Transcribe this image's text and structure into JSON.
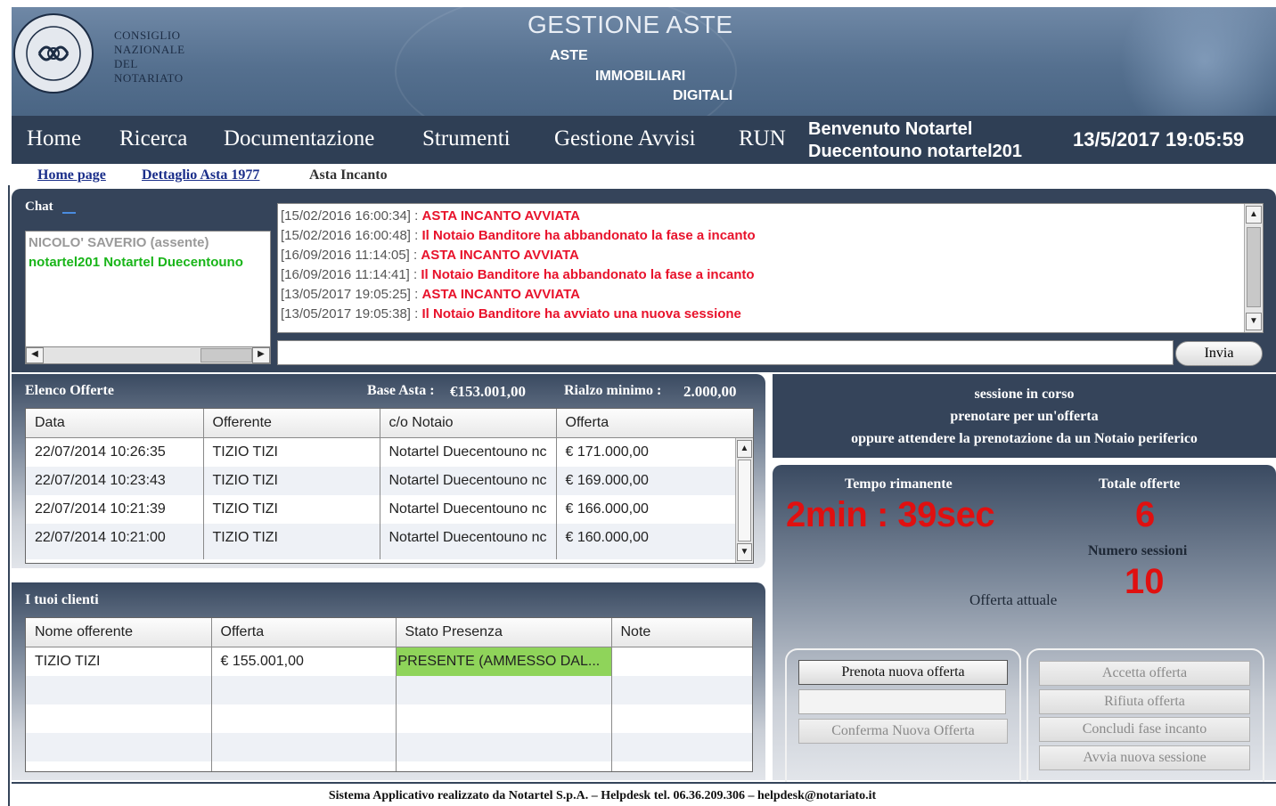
{
  "header": {
    "org_lines": [
      "CONSIGLIO",
      "NAZIONALE",
      "DEL",
      "NOTARIATO"
    ],
    "seal_text": "FIDELI VERITATIS ANCHORA",
    "title": "GESTIONE ASTE",
    "sub1": "ASTE",
    "sub2": "IMMOBILIARI",
    "sub3": "DIGITALI"
  },
  "nav": {
    "items": [
      "Home",
      "Ricerca",
      "Documentazione",
      "Strumenti",
      "Gestione Avvisi",
      "RUN"
    ],
    "welcome_line1": "Benvenuto Notartel",
    "welcome_line2": "Duecentouno notartel201",
    "datetime": "13/5/2017 19:05:59"
  },
  "breadcrumb": {
    "home": "Home page",
    "detail": "Dettaglio Asta 1977",
    "current": "Asta Incanto"
  },
  "chat": {
    "label": "Chat",
    "users": [
      {
        "name": "NICOLO' SAVERIO (assente)",
        "color": "#9a9a9a"
      },
      {
        "name": "notartel201 Notartel Duecentouno",
        "color": "#19b519"
      }
    ],
    "messages": [
      {
        "ts": "[15/02/2016 16:00:34]",
        "sep": " : ",
        "text": "ASTA INCANTO AVVIATA"
      },
      {
        "ts": "[15/02/2016 16:00:48]",
        "sep": " : ",
        "text": "Il Notaio Banditore ha abbandonato la fase a incanto"
      },
      {
        "ts": "[16/09/2016 11:14:05]",
        "sep": " : ",
        "text": "ASTA INCANTO AVVIATA"
      },
      {
        "ts": "[16/09/2016 11:14:41]",
        "sep": " : ",
        "text": "Il Notaio Banditore ha abbandonato la fase a incanto"
      },
      {
        "ts": "[13/05/2017 19:05:25]",
        "sep": " : ",
        "text": "ASTA INCANTO AVVIATA"
      },
      {
        "ts": "[13/05/2017 19:05:38]",
        "sep": " : ",
        "text": "Il Notaio Banditore ha avviato una nuova sessione"
      }
    ],
    "input_value": "",
    "send_label": "Invia"
  },
  "offers": {
    "title": "Elenco Offerte",
    "base_label": "Base Asta :",
    "base_value": "€153.001,00",
    "rilancio_label": "Rialzo minimo :",
    "rilancio_value": "2.000,00",
    "columns": [
      "Data",
      "Offerente",
      "c/o Notaio",
      "Offerta"
    ],
    "rows": [
      [
        "22/07/2014 10:26:35",
        "TIZIO TIZI",
        "Notartel Duecentouno nc",
        "€ 171.000,00"
      ],
      [
        "22/07/2014 10:23:43",
        "TIZIO TIZI",
        "Notartel Duecentouno nc",
        "€ 169.000,00"
      ],
      [
        "22/07/2014 10:21:39",
        "TIZIO TIZI",
        "Notartel Duecentouno nc",
        "€ 166.000,00"
      ],
      [
        "22/07/2014 10:21:00",
        "TIZIO TIZI",
        "Notartel Duecentouno nc",
        "€ 160.000,00"
      ]
    ]
  },
  "clients": {
    "title": "I tuoi clienti",
    "columns": [
      "Nome offerente",
      "Offerta",
      "Stato Presenza",
      "Note"
    ],
    "rows": [
      [
        "TIZIO TIZI",
        "€ 155.001,00",
        "PRESENTE (AMMESSO DAL...",
        ""
      ]
    ]
  },
  "session": {
    "line1": "sessione in corso",
    "line2": "prenotare per un'offerta",
    "line3": "oppure attendere la prenotazione da un Notaio periferico"
  },
  "stats": {
    "tempo_label": "Tempo rimanente",
    "tempo_value": "2min : 39sec",
    "totale_label": "Totale offerte",
    "totale_value": "6",
    "sessioni_label": "Numero sessioni",
    "sessioni_value": "10",
    "offerta_label": "Offerta attuale"
  },
  "actions": {
    "prenota": "Prenota nuova offerta",
    "conferma": "Conferma Nuova Offerta",
    "accetta": "Accetta offerta",
    "rifiuta": "Rifiuta offerta",
    "concludi": "Concludi fase incanto",
    "avvia": "Avvia nuova sessione"
  },
  "footer": {
    "text": "Sistema Applicativo realizzato da Notartel S.p.A. – Helpdesk tel. 06.36.209.306 – helpdesk@notariato.it"
  },
  "colors": {
    "message_red": "#e8122b",
    "timer_red": "#e01010",
    "presence_green": "#8fd45a"
  }
}
